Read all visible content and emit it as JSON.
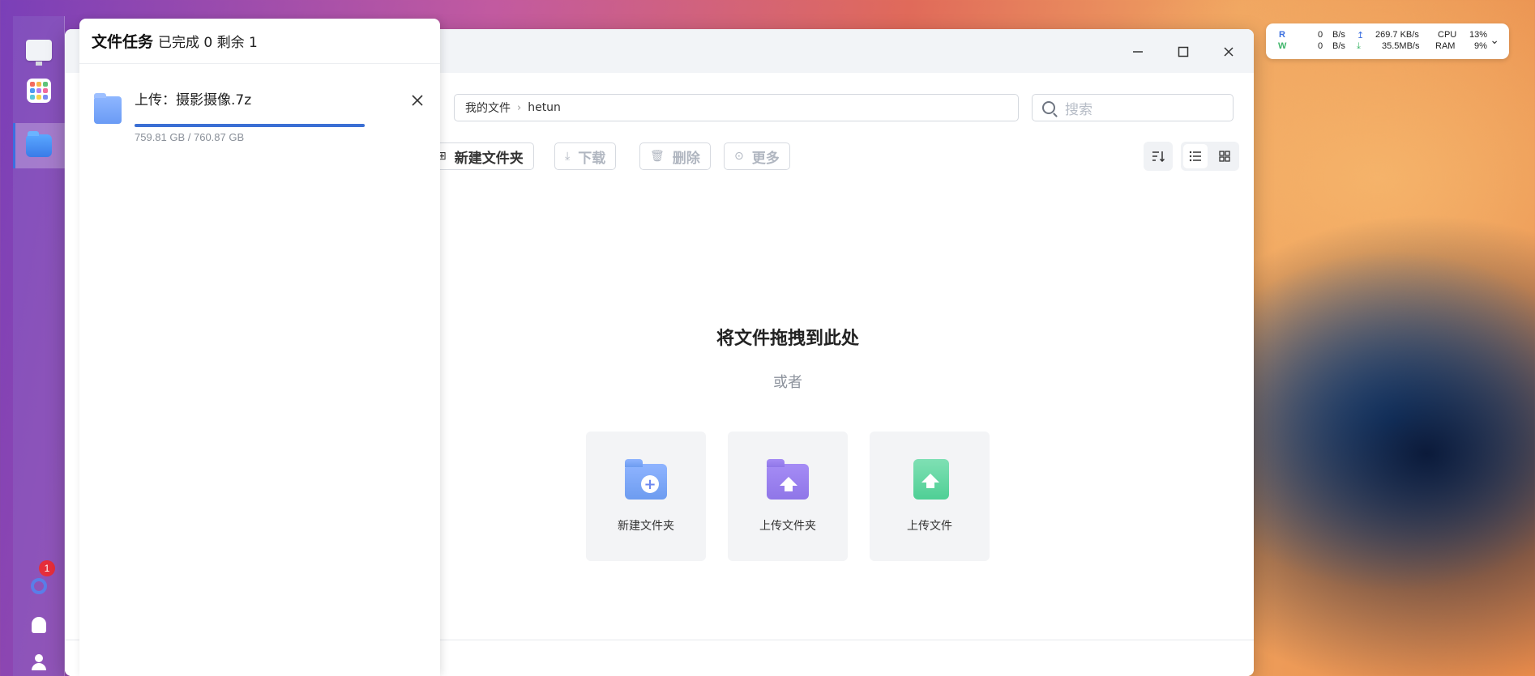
{
  "dock": {
    "items": [
      {
        "name": "desktop",
        "icon": "monitor-icon"
      },
      {
        "name": "app-center",
        "icon": "apps-icon"
      },
      {
        "name": "file-manager",
        "icon": "folder-icon",
        "active": true
      }
    ],
    "bottom": {
      "notification_badge": "1",
      "icons": [
        "settings-icon",
        "bell-icon",
        "user-icon"
      ]
    }
  },
  "task_panel": {
    "title": "文件任务",
    "status": "已完成 0 剩余 1",
    "tasks": [
      {
        "name": "上传：摄影摄像.7z",
        "size": "759.81 GB / 760.87 GB",
        "progress": 0.9986
      }
    ]
  },
  "file_window": {
    "breadcrumb": [
      "我的文件",
      "hetun"
    ],
    "search_placeholder": "搜索",
    "toolbar": {
      "new_folder": "新建文件夹",
      "download": "下载",
      "delete": "删除",
      "more": "更多"
    },
    "empty_state": {
      "title": "将文件拖拽到此处",
      "or": "或者",
      "actions": [
        {
          "label": "新建文件夹",
          "icon": "new-folder-icon"
        },
        {
          "label": "上传文件夹",
          "icon": "upload-folder-icon"
        },
        {
          "label": "上传文件",
          "icon": "upload-file-icon"
        }
      ]
    }
  },
  "system_monitor": {
    "read_label": "R",
    "write_label": "W",
    "read_speed": "0",
    "write_speed": "0",
    "unit": "B/s",
    "upload": "269.7 KB/s",
    "download": "35.5MB/s",
    "cpu_label": "CPU",
    "cpu_value": "13%",
    "ram_label": "RAM",
    "ram_value": "9%"
  },
  "colors": {
    "accent": "#3b6fd4",
    "badge": "#e62e3b",
    "upload_green": "#4fcf95",
    "folder_purple": "#8f76e8",
    "folder_blue": "#6d9cf0"
  }
}
